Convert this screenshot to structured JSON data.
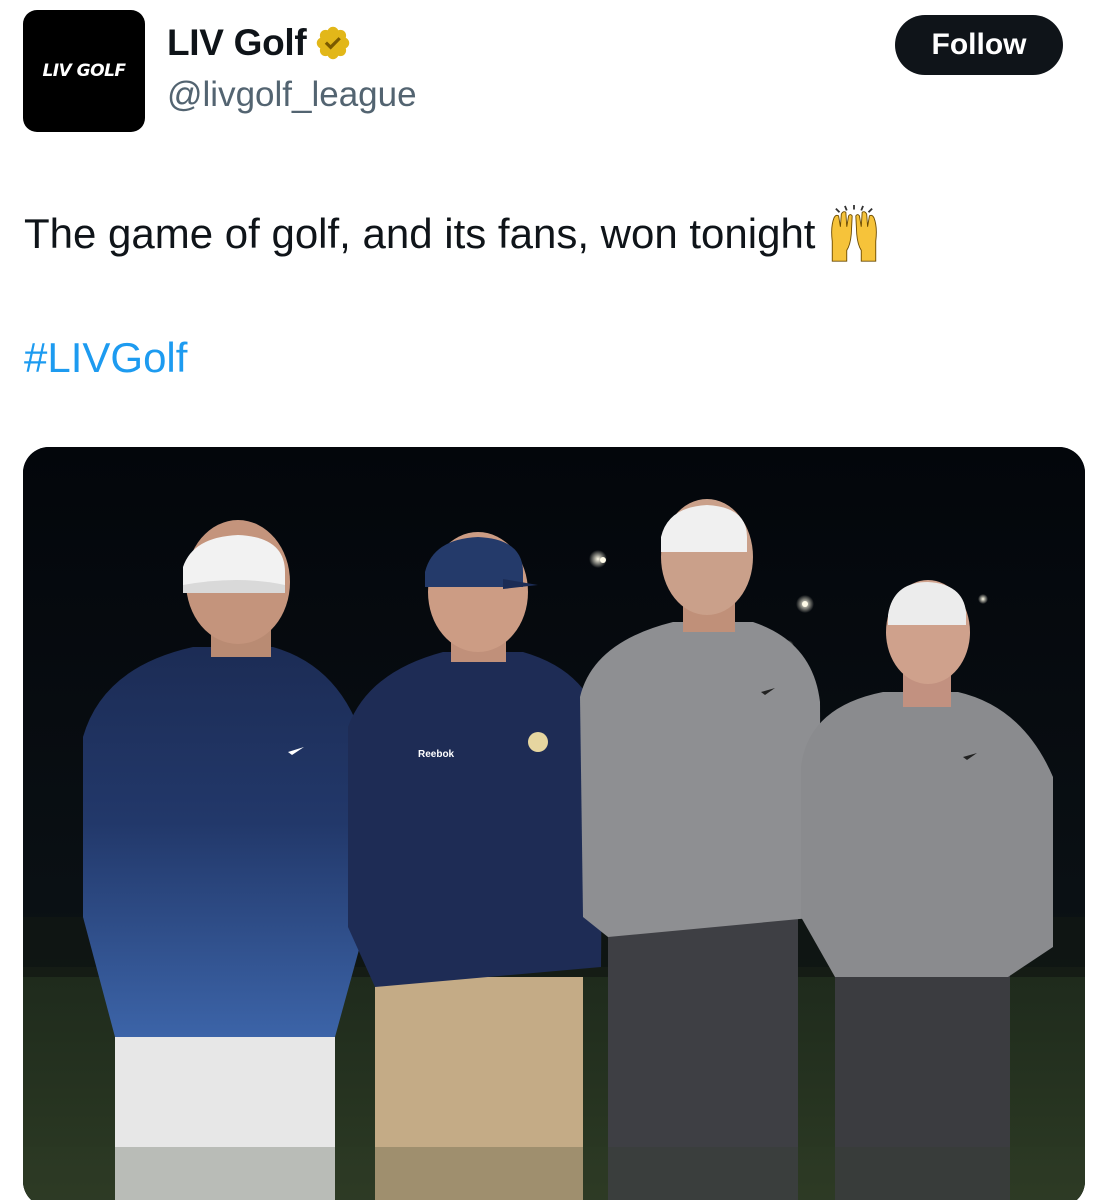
{
  "author": {
    "avatar_logo_text": "LIV GOLF",
    "display_name": "LIV Golf",
    "handle": "@livgolf_league",
    "verified_icon": "verified-badge-gold"
  },
  "actions": {
    "follow_label": "Follow"
  },
  "tweet": {
    "text": "The game of golf, and its fans, won tonight",
    "emoji": "raising-hands",
    "hashtag": "#LIVGolf"
  },
  "media": {
    "kind": "photo",
    "shirt_brand_text": "Reebok"
  },
  "colors": {
    "text_primary": "#0f1419",
    "text_secondary": "#536471",
    "link": "#1d9bf0",
    "follow_bg": "#0f1419",
    "verified_gold": "#e2b719"
  }
}
